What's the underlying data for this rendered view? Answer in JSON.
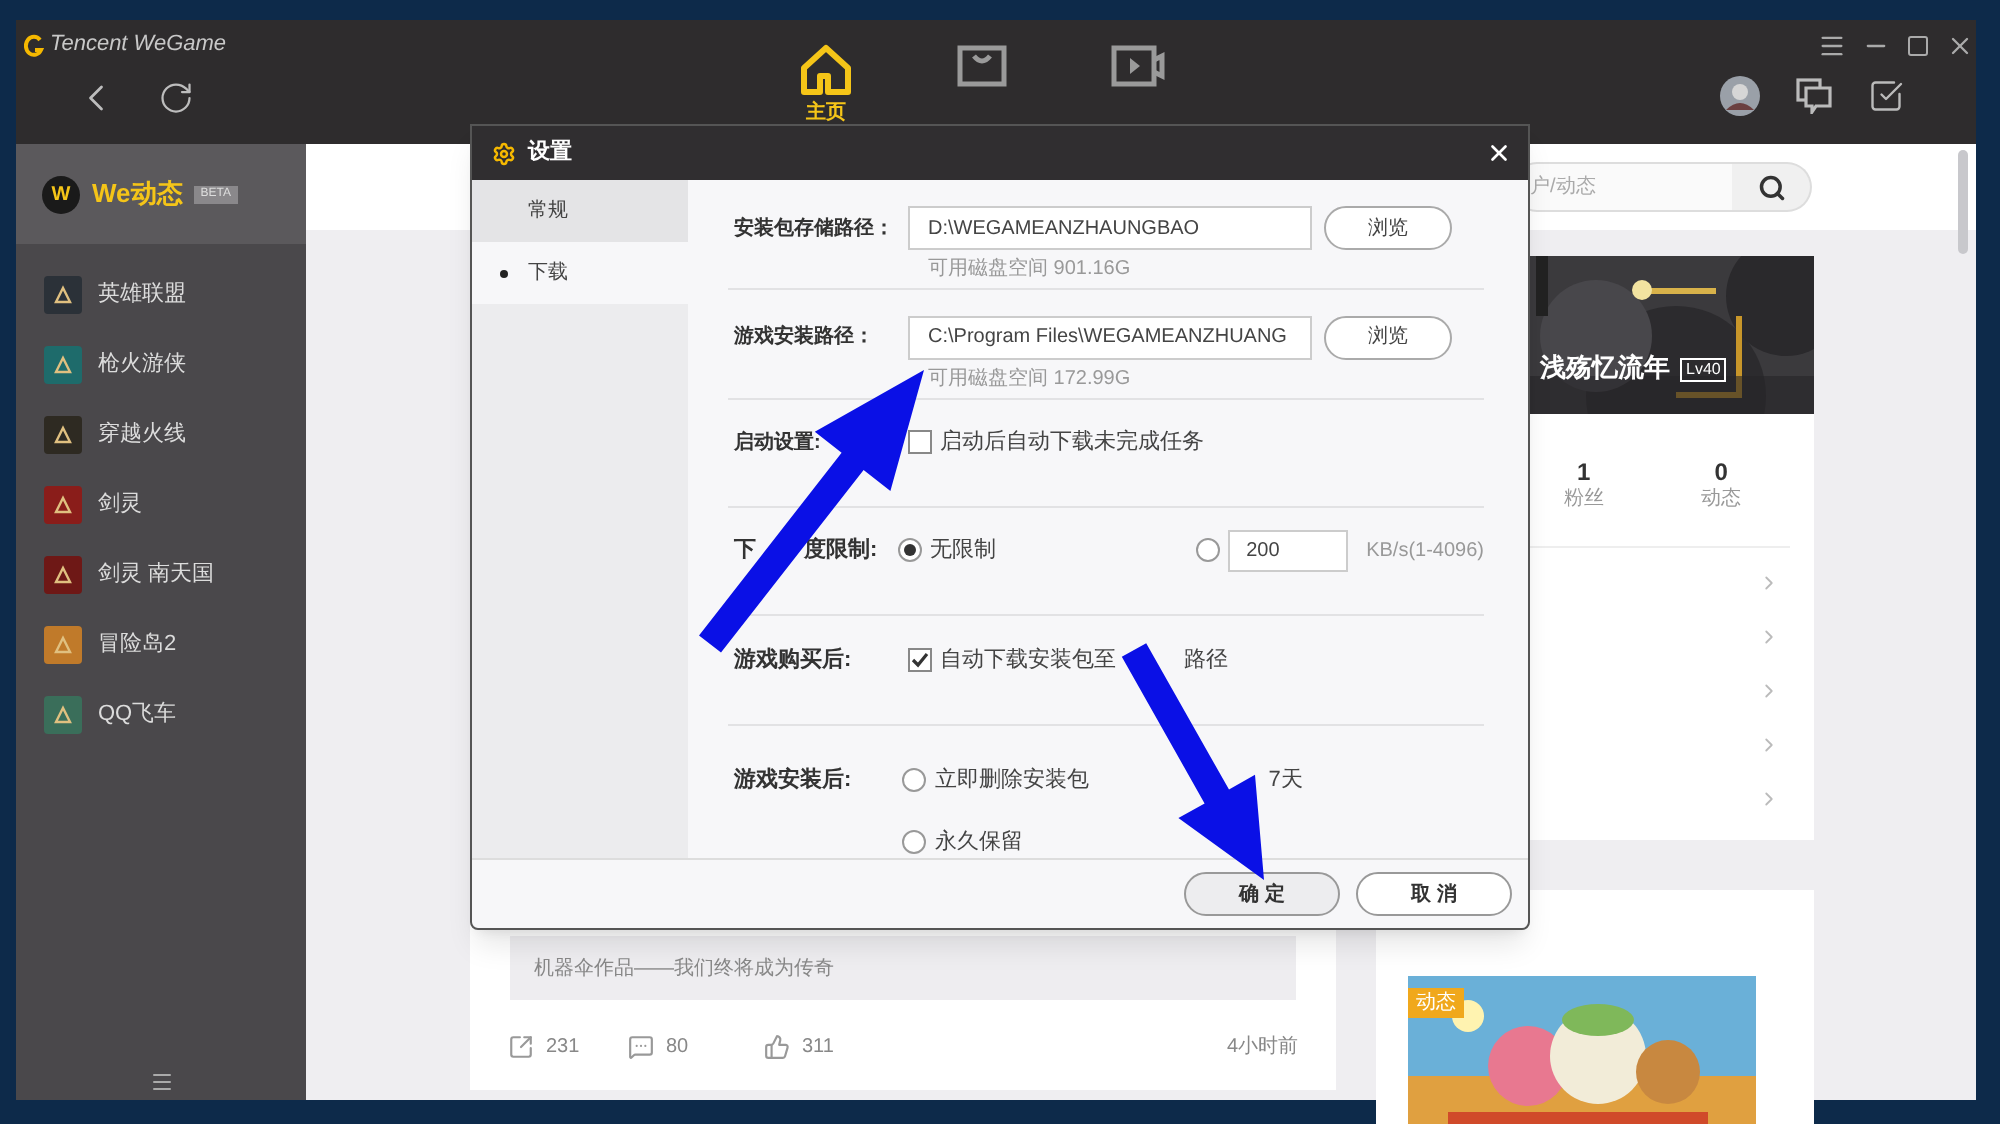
{
  "window": {
    "title": "Tencent WeGame"
  },
  "nav": [
    {
      "kind": "home",
      "label": "主页",
      "selected": true
    },
    {
      "kind": "store",
      "selected": false
    },
    {
      "kind": "video",
      "selected": false
    }
  ],
  "sidebar": {
    "header": {
      "logo": "W",
      "title": "We动态",
      "badge": "BETA"
    },
    "items": [
      {
        "label": "英雄联盟",
        "color": "#2b3138"
      },
      {
        "label": "枪火游侠",
        "color": "#1e6b6b"
      },
      {
        "label": "穿越火线",
        "color": "#2e2a22"
      },
      {
        "label": "剑灵",
        "color": "#8a1d1a"
      },
      {
        "label": "剑灵 南天国",
        "color": "#6e1816"
      },
      {
        "label": "冒险岛2",
        "color": "#c07a2a"
      },
      {
        "label": "QQ飞车",
        "color": "#3a6e5a"
      }
    ]
  },
  "search": {
    "placeholder": "户/动态"
  },
  "profile": {
    "name": "浅殇忆流年",
    "level": "Lv40",
    "stats": [
      {
        "value": "1",
        "label": "粉丝"
      },
      {
        "value": "0",
        "label": "动态"
      }
    ]
  },
  "feed": {
    "caption": "机器伞作品——我们终将成为传奇",
    "shares": "231",
    "comments": "80",
    "likes": "311",
    "time": "4小时前"
  },
  "promo": {
    "badge": "动态"
  },
  "dialog": {
    "title": "设置",
    "nav": [
      {
        "label": "常规",
        "selected": false
      },
      {
        "label": "下载",
        "selected": true
      }
    ],
    "paths": [
      {
        "label": "安装包存储路径：",
        "value": "D:\\WEGAMEANZHAUNGBAO",
        "free": "可用磁盘空间 901.16G",
        "button": "浏览"
      },
      {
        "label": "游戏安装路径：",
        "value": "C:\\Program Files\\WEGAMEANZHUANG",
        "free": "可用磁盘空间 172.99G",
        "button": "浏览"
      }
    ],
    "startup": {
      "label": "启动设置:",
      "option": "启动后自动下载未完成任务",
      "checked": false
    },
    "speed": {
      "label": [
        "下",
        "度限制:"
      ],
      "options": [
        {
          "kind": "unlimited",
          "label": "无限制",
          "selected": true
        },
        {
          "kind": "custom",
          "value": "200",
          "unit": "KB/s(1-4096)",
          "selected": false
        }
      ]
    },
    "purchase": {
      "label": "游戏购买后:",
      "option": [
        "自动下载安装包至",
        "路径"
      ],
      "checked": true
    },
    "after_install": {
      "label": "游戏安装后:",
      "options": [
        {
          "kind": "radio",
          "label": "立即删除安装包",
          "selected": false
        },
        {
          "kind": "covered",
          "label": "7天"
        },
        {
          "kind": "radio",
          "label": "永久保留",
          "selected": false
        }
      ]
    },
    "buttons": [
      {
        "label": "确 定",
        "kind": "primary"
      },
      {
        "label": "取 消",
        "kind": "secondary"
      }
    ]
  }
}
